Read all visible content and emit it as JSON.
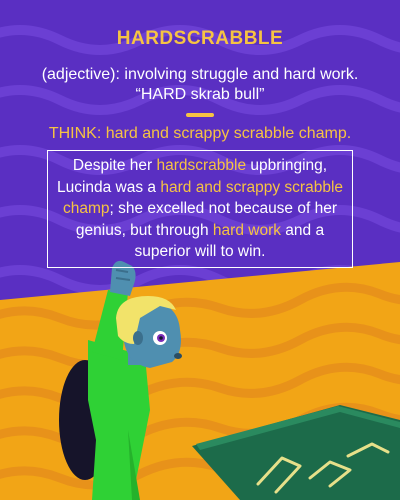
{
  "word": "HARDSCRABBLE",
  "definition": "(adjective): involving struggle and hard work.",
  "pronunciation": "“HARD skrab bull”",
  "think": {
    "label": "THINK:",
    "text": "hard and scrappy scrabble champ."
  },
  "sentence": {
    "part1": "Despite her ",
    "hl1": "hardscrabble",
    "part2": " upbringing, Lucinda was a ",
    "hl2": "hard and scrappy scrabble champ",
    "part3": "; she excelled not because of her genius, but through ",
    "hl3": "hard work",
    "part4": " and a superior will to win."
  },
  "colors": {
    "purple_background": "#5a2fc2",
    "accent_yellow": "#f6c343",
    "orange_floor": "#f2a516",
    "character_shirt": "#2fd135",
    "character_skin": "#4f8fb0",
    "character_hair": "#f2e36a",
    "board_green": "#1c6b4a"
  }
}
